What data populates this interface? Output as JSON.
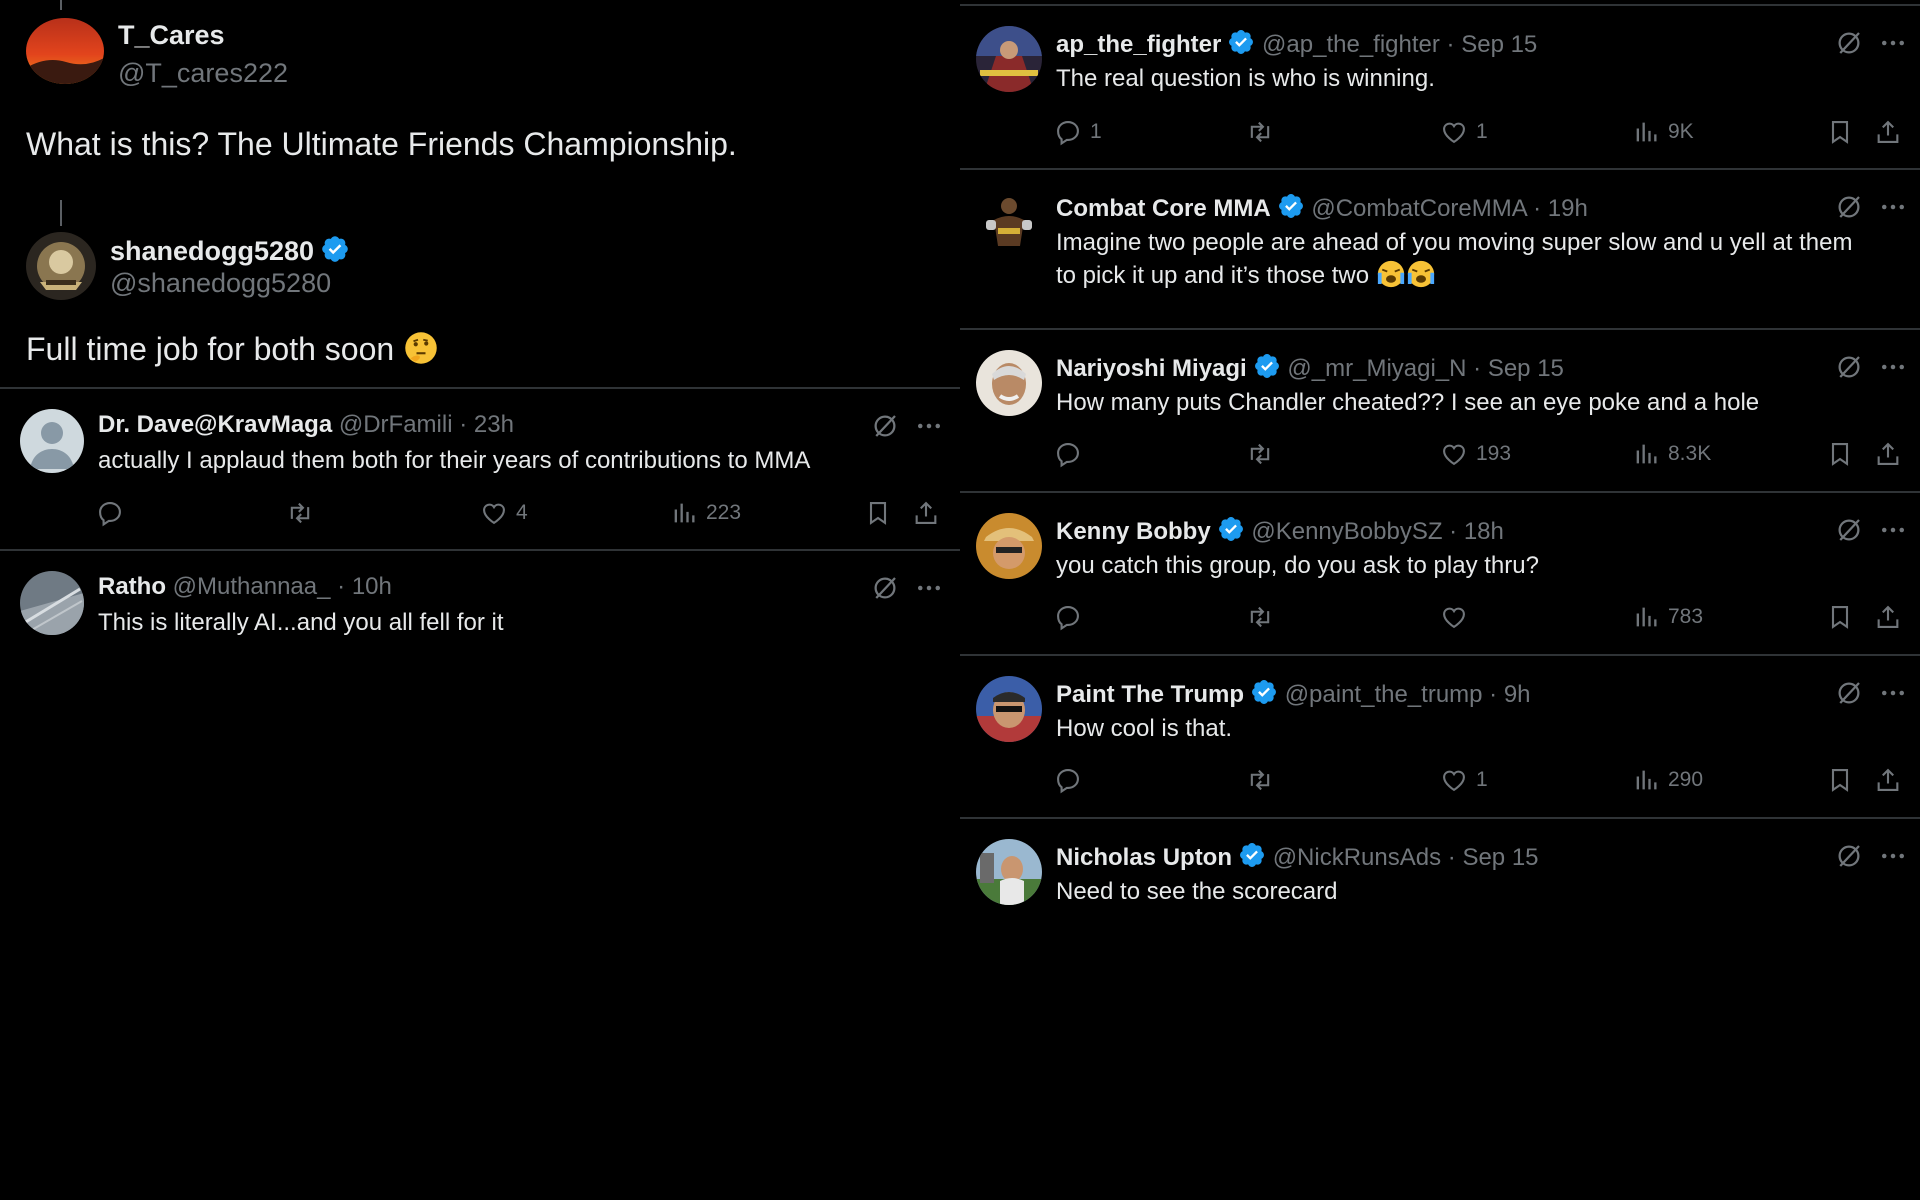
{
  "left": {
    "op1": {
      "name": "T_Cares",
      "handle": "@T_cares222",
      "text": "What is this? The Ultimate Friends Championship."
    },
    "op2": {
      "name": "shanedogg5280",
      "handle": "@shanedogg5280",
      "text": "Full time job for both soon"
    },
    "replies": [
      {
        "name": "Dr. Dave@KravMaga",
        "handle": "@DrFamili",
        "time": "· 23h",
        "text": "actually I applaud them both for their years of contributions to MMA",
        "replies": "",
        "likes": "4",
        "views": "223"
      },
      {
        "name": "Ratho",
        "handle": "@Muthannaa_",
        "time": "· 10h",
        "text": "This is literally AI...and you all fell for it"
      }
    ]
  },
  "right": {
    "replies": [
      {
        "name": "ap_the_fighter",
        "handle": "@ap_the_fighter",
        "time": "· Sep 15",
        "text": "The real question is who is winning.",
        "replies": "1",
        "likes": "1",
        "views": "9K"
      },
      {
        "name": "Combat Core MMA",
        "handle": "@CombatCoreMMA",
        "time": "· 19h",
        "text1": "Imagine two people are ahead of you moving super slow and u yell at them",
        "text2": "to pick it up and it’s those two"
      },
      {
        "name": "Nariyoshi Miyagi",
        "handle": "@_mr_Miyagi_N",
        "time": "· Sep 15",
        "text": "How many puts Chandler cheated?? I see an eye poke and a hole",
        "replies": "",
        "likes": "193",
        "views": "8.3K"
      },
      {
        "name": "Kenny Bobby",
        "handle": "@KennyBobbySZ",
        "time": "· 18h",
        "text": "you catch this group, do you ask to play thru?",
        "replies": "",
        "likes": "",
        "views": "783"
      },
      {
        "name": "Paint The Trump",
        "handle": "@paint_the_trump",
        "time": "· 9h",
        "text": "How cool is that.",
        "replies": "",
        "likes": "1",
        "views": "290"
      },
      {
        "name": "Nicholas Upton",
        "handle": "@NickRunsAds",
        "time": "· Sep 15",
        "text": "Need to see the scorecard"
      }
    ]
  },
  "colors": {
    "background": "#000000",
    "text": "#e7e9ea",
    "muted": "#71767b",
    "verified": "#1d9bf0",
    "divider": "#2f3336"
  }
}
